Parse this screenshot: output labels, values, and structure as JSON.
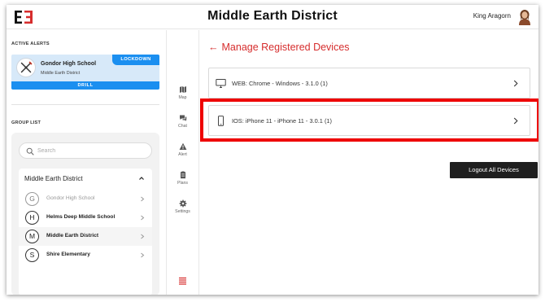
{
  "header": {
    "title": "Middle Earth District",
    "user_name": "King Aragorn"
  },
  "alerts": {
    "section_label": "ACTIVE ALERTS",
    "card": {
      "school": "Gondor High School",
      "district": "Middle Earth District",
      "type_badge": "LOCKDOWN",
      "mode": "DRILL"
    }
  },
  "groups": {
    "section_label": "GROUP LIST",
    "search_placeholder": "Search",
    "district": "Middle Earth District",
    "items": [
      {
        "letter": "G",
        "label": "Gondor High School",
        "state": "disabled"
      },
      {
        "letter": "H",
        "label": "Helms Deep Middle School",
        "state": "normal"
      },
      {
        "letter": "M",
        "label": "Middle Earth District",
        "state": "selected"
      },
      {
        "letter": "S",
        "label": "Shire Elementary",
        "state": "normal"
      }
    ]
  },
  "rail": {
    "items": [
      {
        "label": "Map",
        "icon": "map-icon"
      },
      {
        "label": "Chat",
        "icon": "chat-icon"
      },
      {
        "label": "Alert",
        "icon": "alert-icon"
      },
      {
        "label": "Plans",
        "icon": "plans-icon"
      },
      {
        "label": "Settings",
        "icon": "gear-icon"
      }
    ],
    "menu_icon": "hamburger-icon"
  },
  "main": {
    "back_label": "Manage Registered Devices",
    "devices": [
      {
        "label": "WEB: Chrome - Windows - 3.1.0 (1)",
        "icon": "desktop-icon"
      },
      {
        "label": "IOS: iPhone 11 - iPhone 11 - 3.0.1 (1)",
        "icon": "phone-icon"
      }
    ],
    "logout_label": "Logout All Devices"
  },
  "colors": {
    "accent_red": "#d62d2d",
    "highlight_red": "#ee0000",
    "alert_blue": "#1b8ff0",
    "alert_card_bg": "#d7e9f9",
    "button_dark": "#1f1f1f"
  }
}
